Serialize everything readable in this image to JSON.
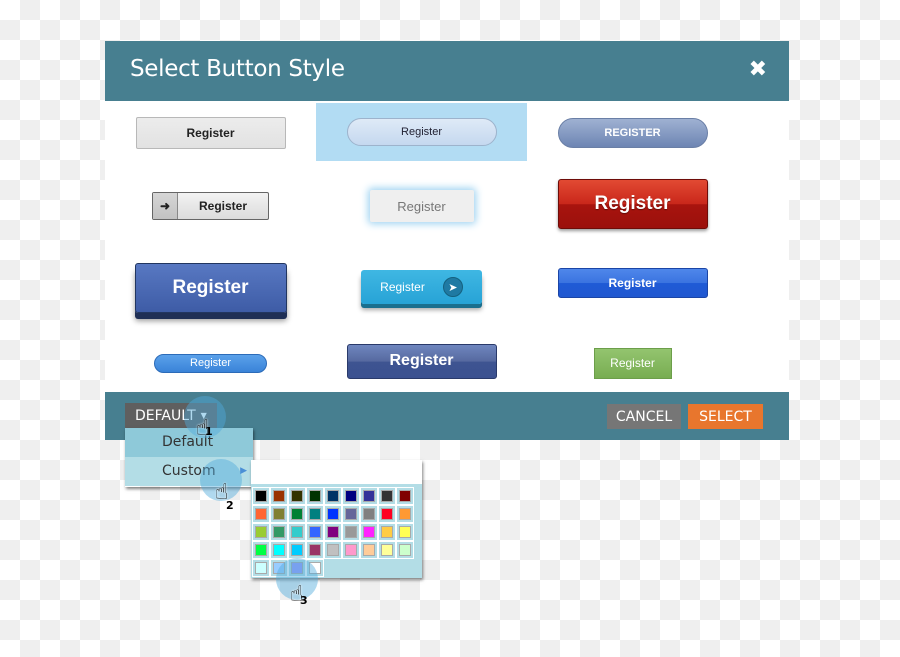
{
  "dialog": {
    "title": "Select Button Style",
    "close_icon": "close-icon"
  },
  "buttons": [
    {
      "label": "Register",
      "style": "gray-flat"
    },
    {
      "label": "Register",
      "style": "light-blue-pill",
      "selected": true
    },
    {
      "label": "REGISTER",
      "style": "slate-pill"
    },
    {
      "label": "Register",
      "style": "gray-arrow-left"
    },
    {
      "label": "Register",
      "style": "glow-light"
    },
    {
      "label": "Register",
      "style": "red-large"
    },
    {
      "label": "Register",
      "style": "blue-3d-large"
    },
    {
      "label": "Register",
      "style": "cyan-arrow-right"
    },
    {
      "label": "Register",
      "style": "blue-gloss"
    },
    {
      "label": "Register",
      "style": "blue-small-pill"
    },
    {
      "label": "Register",
      "style": "navy-bold"
    },
    {
      "label": "Register",
      "style": "green-flat"
    }
  ],
  "footer": {
    "dropdown_label": "DEFAULT",
    "cancel_label": "CANCEL",
    "select_label": "SELECT"
  },
  "menu": {
    "items": [
      {
        "label": "Default"
      },
      {
        "label": "Custom",
        "has_submenu": true
      }
    ]
  },
  "palette": {
    "rows": [
      [
        "#000000",
        "#993300",
        "#333300",
        "#003300",
        "#003366",
        "#000080",
        "#333399",
        "#333333",
        "#800000"
      ],
      [
        "#ff6633",
        "#808033",
        "#008033",
        "#008080",
        "#0033ff",
        "#666699",
        "#808080",
        "#ff0022",
        "#ff9933"
      ],
      [
        "#99cc33",
        "#339966",
        "#33cccc",
        "#3366ff",
        "#800080",
        "#999999",
        "#ff22ff",
        "#ffcc44",
        "#ffff55"
      ],
      [
        "#00ff44",
        "#00ffff",
        "#00ccff",
        "#993366",
        "#c0c0c0",
        "#ff99cc",
        "#ffcc99",
        "#ffff99",
        "#ccffcc"
      ],
      [
        "#ccffff",
        "#99ccff",
        "#9999ff",
        "#ffffff"
      ]
    ]
  },
  "cursor_steps": [
    "1",
    "2",
    "3"
  ],
  "colors": {
    "header": "#477f90",
    "select": "#e8762d",
    "cancel": "#767676"
  }
}
